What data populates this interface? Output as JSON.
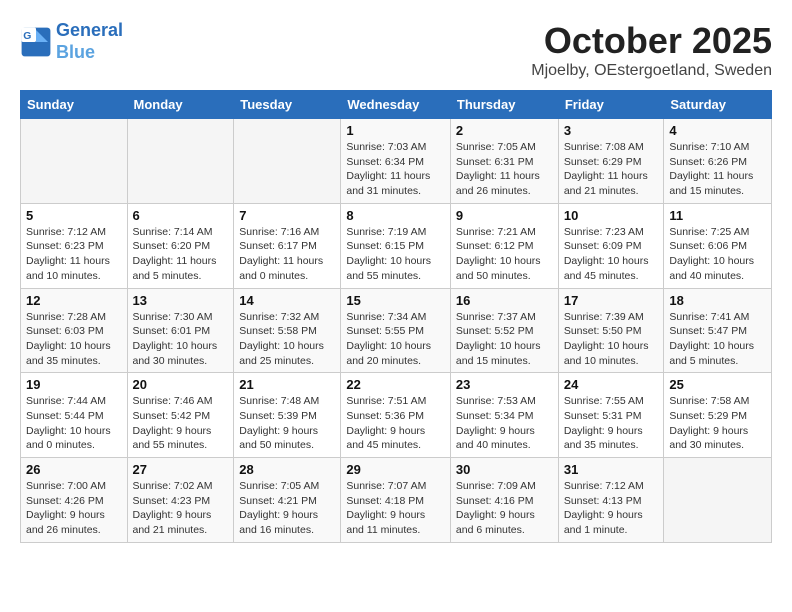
{
  "logo": {
    "line1": "General",
    "line2": "Blue"
  },
  "title": "October 2025",
  "location": "Mjoelby, OEstergoetland, Sweden",
  "headers": [
    "Sunday",
    "Monday",
    "Tuesday",
    "Wednesday",
    "Thursday",
    "Friday",
    "Saturday"
  ],
  "weeks": [
    [
      {
        "day": "",
        "info": ""
      },
      {
        "day": "",
        "info": ""
      },
      {
        "day": "",
        "info": ""
      },
      {
        "day": "1",
        "info": "Sunrise: 7:03 AM\nSunset: 6:34 PM\nDaylight: 11 hours\nand 31 minutes."
      },
      {
        "day": "2",
        "info": "Sunrise: 7:05 AM\nSunset: 6:31 PM\nDaylight: 11 hours\nand 26 minutes."
      },
      {
        "day": "3",
        "info": "Sunrise: 7:08 AM\nSunset: 6:29 PM\nDaylight: 11 hours\nand 21 minutes."
      },
      {
        "day": "4",
        "info": "Sunrise: 7:10 AM\nSunset: 6:26 PM\nDaylight: 11 hours\nand 15 minutes."
      }
    ],
    [
      {
        "day": "5",
        "info": "Sunrise: 7:12 AM\nSunset: 6:23 PM\nDaylight: 11 hours\nand 10 minutes."
      },
      {
        "day": "6",
        "info": "Sunrise: 7:14 AM\nSunset: 6:20 PM\nDaylight: 11 hours\nand 5 minutes."
      },
      {
        "day": "7",
        "info": "Sunrise: 7:16 AM\nSunset: 6:17 PM\nDaylight: 11 hours\nand 0 minutes."
      },
      {
        "day": "8",
        "info": "Sunrise: 7:19 AM\nSunset: 6:15 PM\nDaylight: 10 hours\nand 55 minutes."
      },
      {
        "day": "9",
        "info": "Sunrise: 7:21 AM\nSunset: 6:12 PM\nDaylight: 10 hours\nand 50 minutes."
      },
      {
        "day": "10",
        "info": "Sunrise: 7:23 AM\nSunset: 6:09 PM\nDaylight: 10 hours\nand 45 minutes."
      },
      {
        "day": "11",
        "info": "Sunrise: 7:25 AM\nSunset: 6:06 PM\nDaylight: 10 hours\nand 40 minutes."
      }
    ],
    [
      {
        "day": "12",
        "info": "Sunrise: 7:28 AM\nSunset: 6:03 PM\nDaylight: 10 hours\nand 35 minutes."
      },
      {
        "day": "13",
        "info": "Sunrise: 7:30 AM\nSunset: 6:01 PM\nDaylight: 10 hours\nand 30 minutes."
      },
      {
        "day": "14",
        "info": "Sunrise: 7:32 AM\nSunset: 5:58 PM\nDaylight: 10 hours\nand 25 minutes."
      },
      {
        "day": "15",
        "info": "Sunrise: 7:34 AM\nSunset: 5:55 PM\nDaylight: 10 hours\nand 20 minutes."
      },
      {
        "day": "16",
        "info": "Sunrise: 7:37 AM\nSunset: 5:52 PM\nDaylight: 10 hours\nand 15 minutes."
      },
      {
        "day": "17",
        "info": "Sunrise: 7:39 AM\nSunset: 5:50 PM\nDaylight: 10 hours\nand 10 minutes."
      },
      {
        "day": "18",
        "info": "Sunrise: 7:41 AM\nSunset: 5:47 PM\nDaylight: 10 hours\nand 5 minutes."
      }
    ],
    [
      {
        "day": "19",
        "info": "Sunrise: 7:44 AM\nSunset: 5:44 PM\nDaylight: 10 hours\nand 0 minutes."
      },
      {
        "day": "20",
        "info": "Sunrise: 7:46 AM\nSunset: 5:42 PM\nDaylight: 9 hours\nand 55 minutes."
      },
      {
        "day": "21",
        "info": "Sunrise: 7:48 AM\nSunset: 5:39 PM\nDaylight: 9 hours\nand 50 minutes."
      },
      {
        "day": "22",
        "info": "Sunrise: 7:51 AM\nSunset: 5:36 PM\nDaylight: 9 hours\nand 45 minutes."
      },
      {
        "day": "23",
        "info": "Sunrise: 7:53 AM\nSunset: 5:34 PM\nDaylight: 9 hours\nand 40 minutes."
      },
      {
        "day": "24",
        "info": "Sunrise: 7:55 AM\nSunset: 5:31 PM\nDaylight: 9 hours\nand 35 minutes."
      },
      {
        "day": "25",
        "info": "Sunrise: 7:58 AM\nSunset: 5:29 PM\nDaylight: 9 hours\nand 30 minutes."
      }
    ],
    [
      {
        "day": "26",
        "info": "Sunrise: 7:00 AM\nSunset: 4:26 PM\nDaylight: 9 hours\nand 26 minutes."
      },
      {
        "day": "27",
        "info": "Sunrise: 7:02 AM\nSunset: 4:23 PM\nDaylight: 9 hours\nand 21 minutes."
      },
      {
        "day": "28",
        "info": "Sunrise: 7:05 AM\nSunset: 4:21 PM\nDaylight: 9 hours\nand 16 minutes."
      },
      {
        "day": "29",
        "info": "Sunrise: 7:07 AM\nSunset: 4:18 PM\nDaylight: 9 hours\nand 11 minutes."
      },
      {
        "day": "30",
        "info": "Sunrise: 7:09 AM\nSunset: 4:16 PM\nDaylight: 9 hours\nand 6 minutes."
      },
      {
        "day": "31",
        "info": "Sunrise: 7:12 AM\nSunset: 4:13 PM\nDaylight: 9 hours\nand 1 minute."
      },
      {
        "day": "",
        "info": ""
      }
    ]
  ]
}
